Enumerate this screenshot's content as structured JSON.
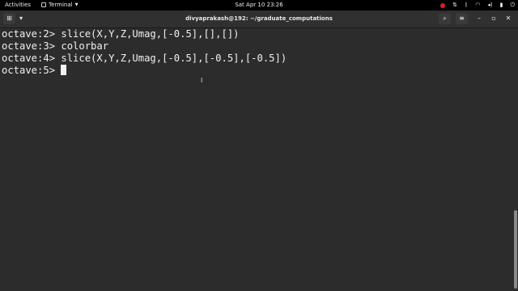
{
  "topbar": {
    "activities": "Activities",
    "app_name": "Terminal",
    "clock": "Sat Apr 10  23:26",
    "icons": [
      "record-icon",
      "network-icon",
      "bluetooth-icon",
      "wifi-icon",
      "volume-icon",
      "battery-icon",
      "power-icon"
    ]
  },
  "headerbar": {
    "title": "divyaprakash@192: ~/graduate_computations",
    "icons": [
      "new-tab-icon",
      "dropdown-icon",
      "search-icon",
      "hamburger-menu-icon",
      "minimize-icon",
      "maximize-icon",
      "close-icon"
    ]
  },
  "terminal": {
    "lines": [
      "octave:2> slice(X,Y,Z,Umag,[-0.5],[],[])",
      "octave:3> colorbar",
      "octave:4> slice(X,Y,Z,Umag,[-0.5],[-0.5],[-0.5])",
      "octave:5>"
    ]
  }
}
